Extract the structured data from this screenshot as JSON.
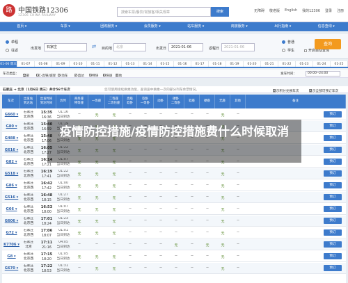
{
  "header": {
    "logo_glyph": "路",
    "brand": "中国铁路12306",
    "brand_sub": "12306 CHINA RAILWAY",
    "search_placeholder": "搜索车票/餐饮/常旅客/相关规章",
    "search_button": "搜索",
    "top_links": [
      "无障碍",
      "敬老版",
      "English",
      "我的12306",
      "登录",
      "注册"
    ]
  },
  "nav": [
    "首页",
    "车票",
    "团购服务",
    "会员服务",
    "站车服务",
    "商旅服务",
    "出行指南",
    "信息查询"
  ],
  "query": {
    "trip_types": [
      {
        "label": "单程",
        "selected": true
      },
      {
        "label": "往返",
        "selected": false
      }
    ],
    "from_label": "出发地",
    "from_value": "石家庄",
    "to_label": "目的地",
    "to_value": "北京",
    "depart_label": "出发日",
    "depart_value": "2021-01-06",
    "return_label": "返程日",
    "return_value": "2021-01-06",
    "passenger_types": [
      {
        "label": "普通",
        "selected": true
      },
      {
        "label": "学生",
        "selected": false
      }
    ],
    "high_speed": "开启自动查询",
    "query_button": "查询"
  },
  "dates": [
    "01-06 周三",
    "01-07",
    "01-08",
    "01-09",
    "01-10",
    "01-11",
    "01-12",
    "01-13",
    "01-14",
    "01-15",
    "01-16",
    "01-17",
    "01-18",
    "01-19",
    "01-20",
    "01-21",
    "01-22",
    "01-23",
    "01-24",
    "01-25"
  ],
  "filters": {
    "type_label": "车次类型：",
    "types": [
      "全部",
      "GC-高铁/城际",
      "D-动车",
      "Z-直达",
      "T-特快",
      "K-快速",
      "其他"
    ],
    "time_label": "发车时间：",
    "time_value": "00:00--24:00"
  },
  "result_bar": {
    "route": "石家庄 → 北京（1月6日 周三）共计56个车次",
    "notice": "您可使用接续换乘功能，查询途中换乘一次的部分列车余票情况。",
    "options": [
      "显示积分兑换车次",
      "显示全部可预订车次"
    ]
  },
  "table": {
    "headers": [
      "车次",
      "出发站\n到达站",
      "出发时间\n到达时间",
      "历时",
      "商务座\n特等座",
      "一等座",
      "二等座\n二等包座",
      "高级\n软卧",
      "软卧\n一等卧",
      "动卧",
      "硬卧\n二等卧",
      "软座",
      "硬座",
      "无座",
      "其他",
      "备注"
    ],
    "rows": [
      {
        "train": "G660",
        "from": "石家庄",
        "to": "北京西",
        "dep": "15:35",
        "arr": "16:36",
        "dur": "01:16",
        "day": "当日到达",
        "seats": [
          "--",
          "无",
          "无",
          "--",
          "--",
          "--",
          "--",
          "--",
          "--",
          "无",
          "--"
        ]
      },
      {
        "train": "G80",
        "from": "石家庄",
        "to": "北京西",
        "dep": "15:40",
        "arr": "16:59",
        "dur": "01:19",
        "day": "当日到达",
        "seats": [
          "无",
          "无",
          "无",
          "--",
          "--",
          "--",
          "--",
          "--",
          "--",
          "无",
          "--"
        ]
      },
      {
        "train": "G488",
        "from": "石家庄",
        "to": "北京西",
        "dep": "15:48",
        "arr": "17:06",
        "dur": "01:18",
        "day": "当日到达",
        "seats": [
          "无",
          "无",
          "无",
          "--",
          "--",
          "--",
          "--",
          "--",
          "--",
          "无",
          "--"
        ]
      },
      {
        "train": "G616",
        "from": "石家庄",
        "to": "北京西",
        "dep": "16:05",
        "arr": "17:27",
        "dur": "01:22",
        "day": "当日到达",
        "seats": [
          "无",
          "无",
          "无",
          "--",
          "--",
          "--",
          "--",
          "--",
          "--",
          "无",
          "--"
        ]
      },
      {
        "train": "G82",
        "from": "石家庄",
        "to": "北京西",
        "dep": "16:14",
        "arr": "17:21",
        "dur": "01:07",
        "day": "当日到达",
        "seats": [
          "无",
          "无",
          "无",
          "--",
          "--",
          "--",
          "--",
          "--",
          "--",
          "无",
          "--"
        ]
      },
      {
        "train": "G518",
        "from": "石家庄",
        "to": "北京西",
        "dep": "16:19",
        "arr": "17:41",
        "dur": "01:22",
        "day": "当日到达",
        "seats": [
          "无",
          "无",
          "无",
          "--",
          "--",
          "--",
          "--",
          "--",
          "--",
          "无",
          "--"
        ]
      },
      {
        "train": "G86",
        "from": "石家庄",
        "to": "北京西",
        "dep": "16:42",
        "arr": "17:42",
        "dur": "01:00",
        "day": "当日到达",
        "seats": [
          "无",
          "无",
          "无",
          "--",
          "--",
          "--",
          "--",
          "--",
          "--",
          "无",
          "--"
        ]
      },
      {
        "train": "G516",
        "from": "石家庄",
        "to": "北京西",
        "dep": "16:48",
        "arr": "18:15",
        "dur": "01:27",
        "day": "当日到达",
        "seats": [
          "无",
          "无",
          "无",
          "--",
          "--",
          "--",
          "--",
          "--",
          "--",
          "无",
          "--"
        ]
      },
      {
        "train": "G66",
        "from": "石家庄",
        "to": "北京西",
        "dep": "16:53",
        "arr": "18:00",
        "dur": "01:07",
        "day": "当日到达",
        "seats": [
          "无",
          "无",
          "无",
          "--",
          "--",
          "--",
          "--",
          "--",
          "--",
          "无",
          "--"
        ]
      },
      {
        "train": "G606",
        "from": "石家庄",
        "to": "北京西",
        "dep": "17:01",
        "arr": "18:24",
        "dur": "01:23",
        "day": "当日到达",
        "seats": [
          "无",
          "无",
          "无",
          "--",
          "--",
          "--",
          "--",
          "--",
          "--",
          "无",
          "--"
        ]
      },
      {
        "train": "G72",
        "from": "石家庄",
        "to": "北京西",
        "dep": "17:06",
        "arr": "18:07",
        "dur": "01:01",
        "day": "当日到达",
        "seats": [
          "无",
          "无",
          "无",
          "--",
          "--",
          "--",
          "--",
          "--",
          "--",
          "无",
          "--"
        ]
      },
      {
        "train": "K7706",
        "from": "石家庄",
        "to": "北京",
        "dep": "17:11",
        "arr": "21:16",
        "dur": "04:05",
        "day": "当日到达",
        "seats": [
          "--",
          "--",
          "--",
          "--",
          "--",
          "--",
          "无",
          "--",
          "无",
          "无",
          "--"
        ]
      },
      {
        "train": "G8",
        "from": "石家庄",
        "to": "北京西",
        "dep": "17:15",
        "arr": "18:20",
        "dur": "01:05",
        "day": "当日到达",
        "seats": [
          "无",
          "无",
          "无",
          "--",
          "--",
          "--",
          "--",
          "--",
          "--",
          "无",
          "--"
        ]
      },
      {
        "train": "G670",
        "from": "石家庄",
        "to": "北京西",
        "dep": "17:22",
        "arr": "18:53",
        "dur": "01:31",
        "day": "当日到达",
        "seats": [
          "--",
          "无",
          "无",
          "--",
          "--",
          "--",
          "--",
          "--",
          "--",
          "无",
          "--"
        ]
      }
    ],
    "book_label": "预订"
  },
  "overlay": {
    "title": "疫情防控措施/疫情防控措施费什么时候取消"
  }
}
